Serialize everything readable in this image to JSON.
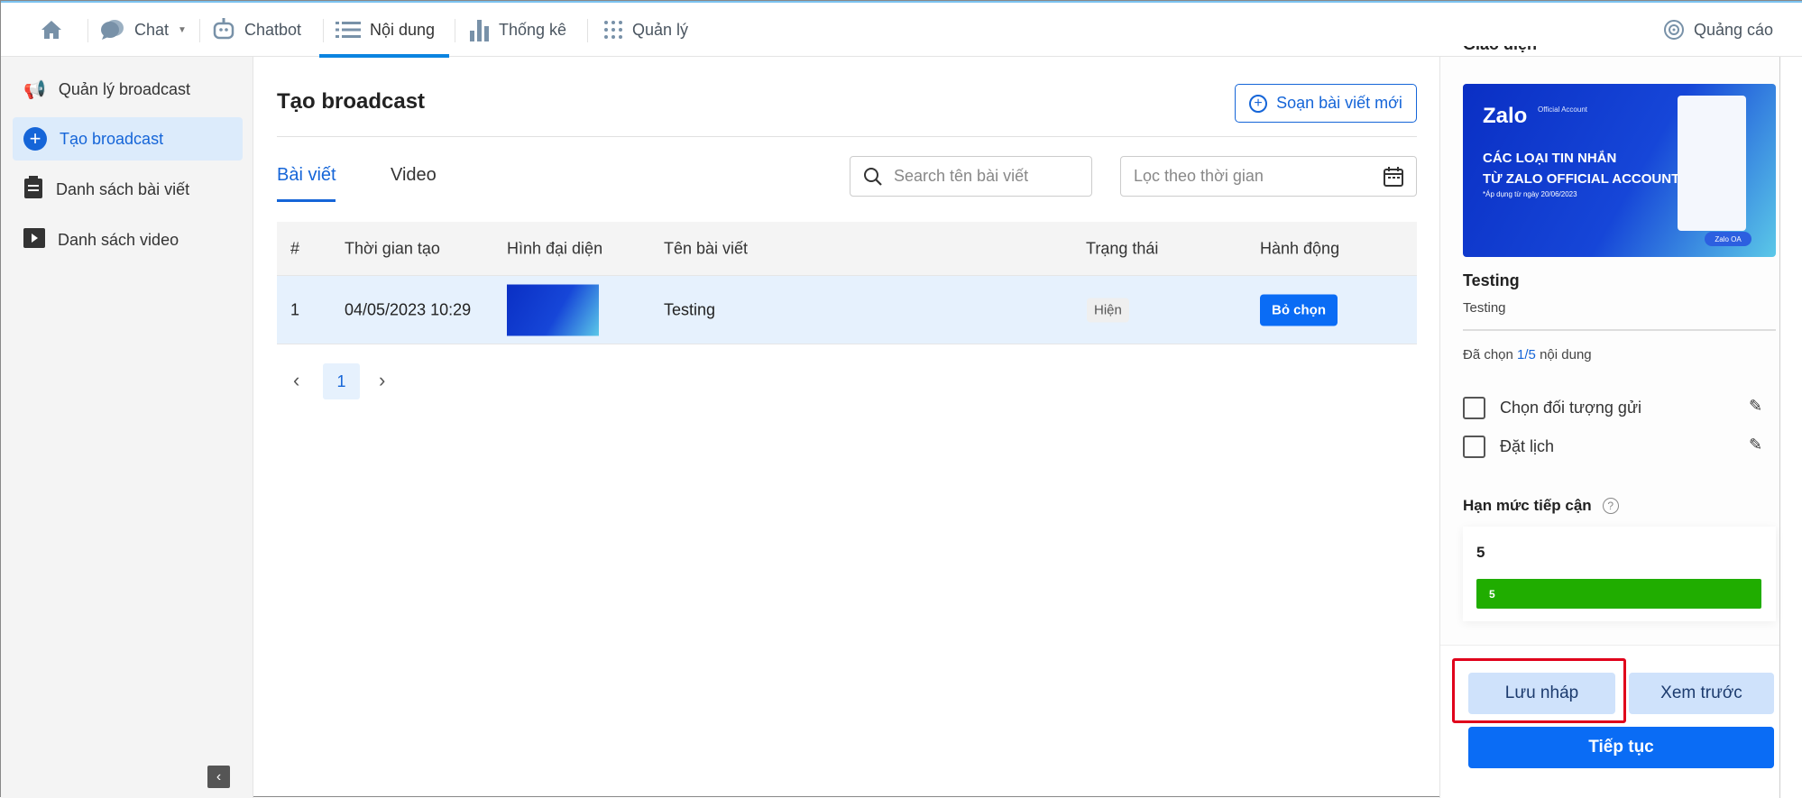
{
  "topnav": {
    "items": [
      {
        "label": "",
        "icon": "home-icon"
      },
      {
        "label": "Chat",
        "icon": "chat-icon"
      },
      {
        "label": "Chatbot",
        "icon": "robot-icon"
      },
      {
        "label": "Nội dung",
        "icon": "list-icon",
        "active": true
      },
      {
        "label": "Thống kê",
        "icon": "bar-chart-icon"
      },
      {
        "label": "Quản lý",
        "icon": "grid-icon"
      }
    ],
    "ads": "Quảng cáo"
  },
  "sidebar": {
    "items": [
      {
        "label": "Quản lý broadcast"
      },
      {
        "label": "Tạo broadcast",
        "active": true
      },
      {
        "label": "Danh sách bài viết"
      },
      {
        "label": "Danh sách video"
      }
    ]
  },
  "main": {
    "title": "Tạo broadcast",
    "new_post": "Soạn bài viết mới",
    "tabs": [
      "Bài viết",
      "Video"
    ],
    "search_placeholder": "Search tên bài viết",
    "date_placeholder": "Lọc theo thời gian",
    "columns": [
      "#",
      "Thời gian tạo",
      "Hình đại diện",
      "Tên bài viết",
      "Trạng thái",
      "Hành động"
    ],
    "rows": [
      {
        "index": "1",
        "created": "04/05/2023 10:29",
        "name": "Testing",
        "status": "Hiện",
        "action": "Bỏ chọn"
      }
    ],
    "page": "1"
  },
  "panel": {
    "section": "Giao diện",
    "banner": {
      "brand": "Zalo",
      "brand_sub": "Official Account",
      "line1": "CÁC LOẠI TIN NHẮN",
      "line2": "TỪ ZALO OFFICIAL ACCOUNT",
      "note": "*Áp dụng từ ngày 20/06/2023",
      "badge": "Zalo OA"
    },
    "post_title": "Testing",
    "post_desc": "Testing",
    "selected_prefix": "Đã chọn ",
    "selected_count": "1/5",
    "selected_suffix": " nội dung",
    "options": [
      "Chọn đối tượng gửi",
      "Đặt lịch"
    ],
    "quota_label": "Hạn mức tiếp cận",
    "quota_value": "5",
    "quota_bar": "5",
    "quota_fill_percent": 100,
    "save_draft": "Lưu nháp",
    "preview": "Xem trước",
    "continue": "Tiếp tục"
  },
  "colors": {
    "accent": "#0a6cf5",
    "success": "#20ad00",
    "highlight": "#e0001b"
  }
}
